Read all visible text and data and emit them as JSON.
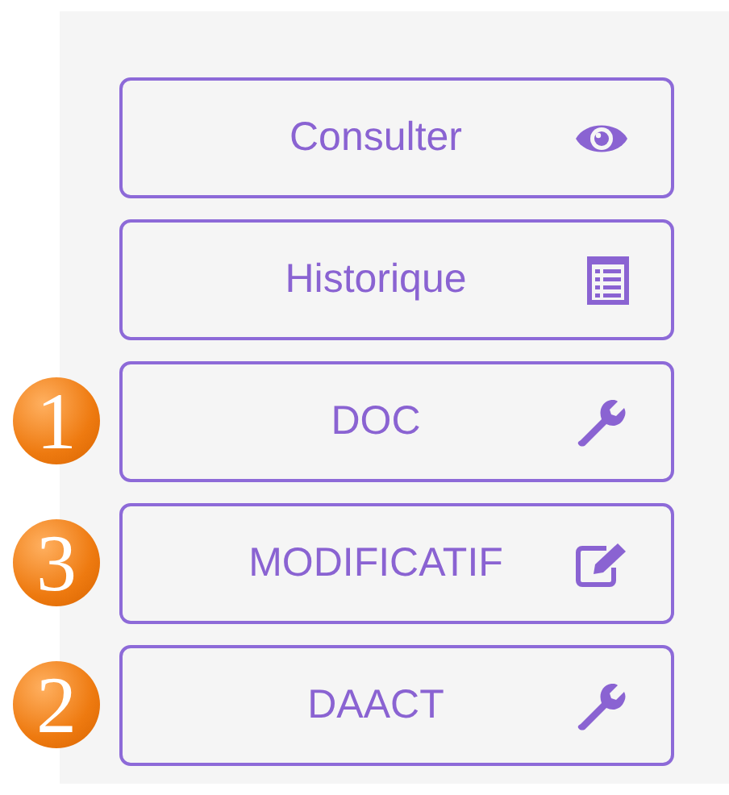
{
  "buttons": [
    {
      "label": "Consulter",
      "kind": "eye"
    },
    {
      "label": "Historique",
      "kind": "list"
    },
    {
      "label": "DOC",
      "kind": "wrench",
      "badge": "1"
    },
    {
      "label": "MODIFICATIF",
      "kind": "edit",
      "badge": "3"
    },
    {
      "label": "DAACT",
      "kind": "wrench",
      "badge": "2"
    }
  ]
}
